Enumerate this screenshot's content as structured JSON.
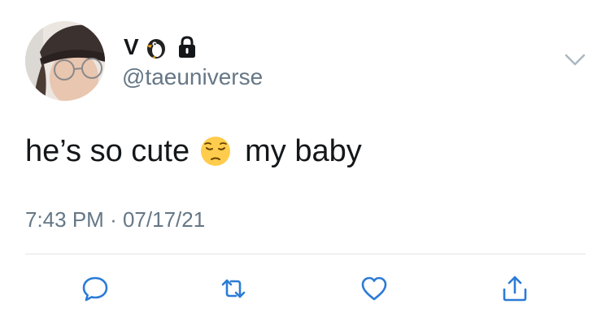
{
  "user": {
    "display_name": "V",
    "handle": "@taeuniverse",
    "badges": [
      "penguin-icon",
      "lock-icon"
    ]
  },
  "tweet": {
    "text_before_emoji": "he’s so cute",
    "emoji": "pensive-face-emoji",
    "text_after_emoji": "my baby",
    "time": "7:43 PM",
    "separator": "·",
    "date": "07/17/21"
  },
  "actions": [
    "reply-icon",
    "retweet-icon",
    "like-icon",
    "share-icon"
  ],
  "colors": {
    "text": "#14171a",
    "secondary": "#657786",
    "icon": "#2c7bd6",
    "divider": "#dfe3e6"
  }
}
